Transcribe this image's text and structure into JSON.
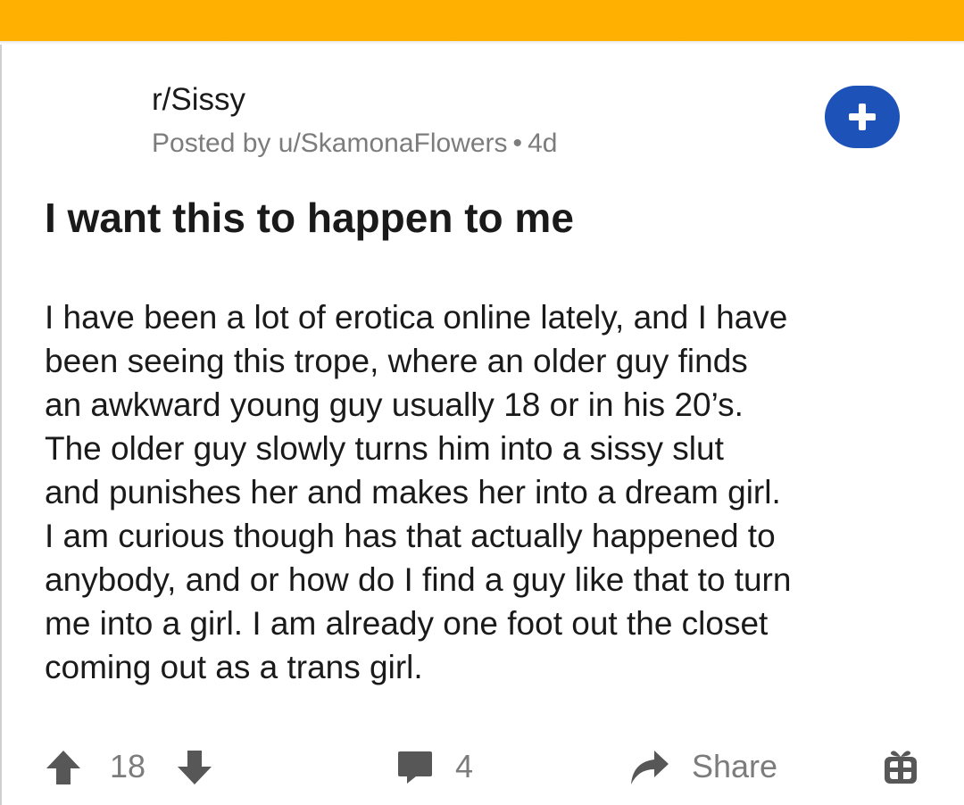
{
  "post": {
    "subreddit": "r/Sissy",
    "posted_by_prefix": "Posted by",
    "author": "u/SkamonaFlowers",
    "separator": "•",
    "age": "4d",
    "title": "I want this to happen to me",
    "body_lines": [
      "I have been a lot of erotica online lately, and I have",
      "been seeing this trope, where an older guy finds",
      "an awkward young guy usually 18 or in his 20’s.",
      "The older guy slowly turns him into a sissy slut",
      "and punishes her and makes her into a dream girl.",
      "I am curious though has that actually happened to",
      "anybody, and or how do I find a guy like that to turn",
      "me into a girl. I am already one foot out the closet",
      "coming out as a trans girl."
    ]
  },
  "actions": {
    "vote_count": "18",
    "comment_count": "4",
    "share_label": "Share"
  },
  "icons": {
    "join": "plus-icon",
    "upvote": "arrow-up-icon",
    "downvote": "arrow-down-icon",
    "comments": "comment-bubble-icon",
    "share": "share-arrow-icon",
    "award": "gift-icon"
  },
  "colors": {
    "top_bar": "#ffb000",
    "join_button": "#1d52b8",
    "text": "#1a1a1b",
    "muted": "#7c7c7c"
  }
}
